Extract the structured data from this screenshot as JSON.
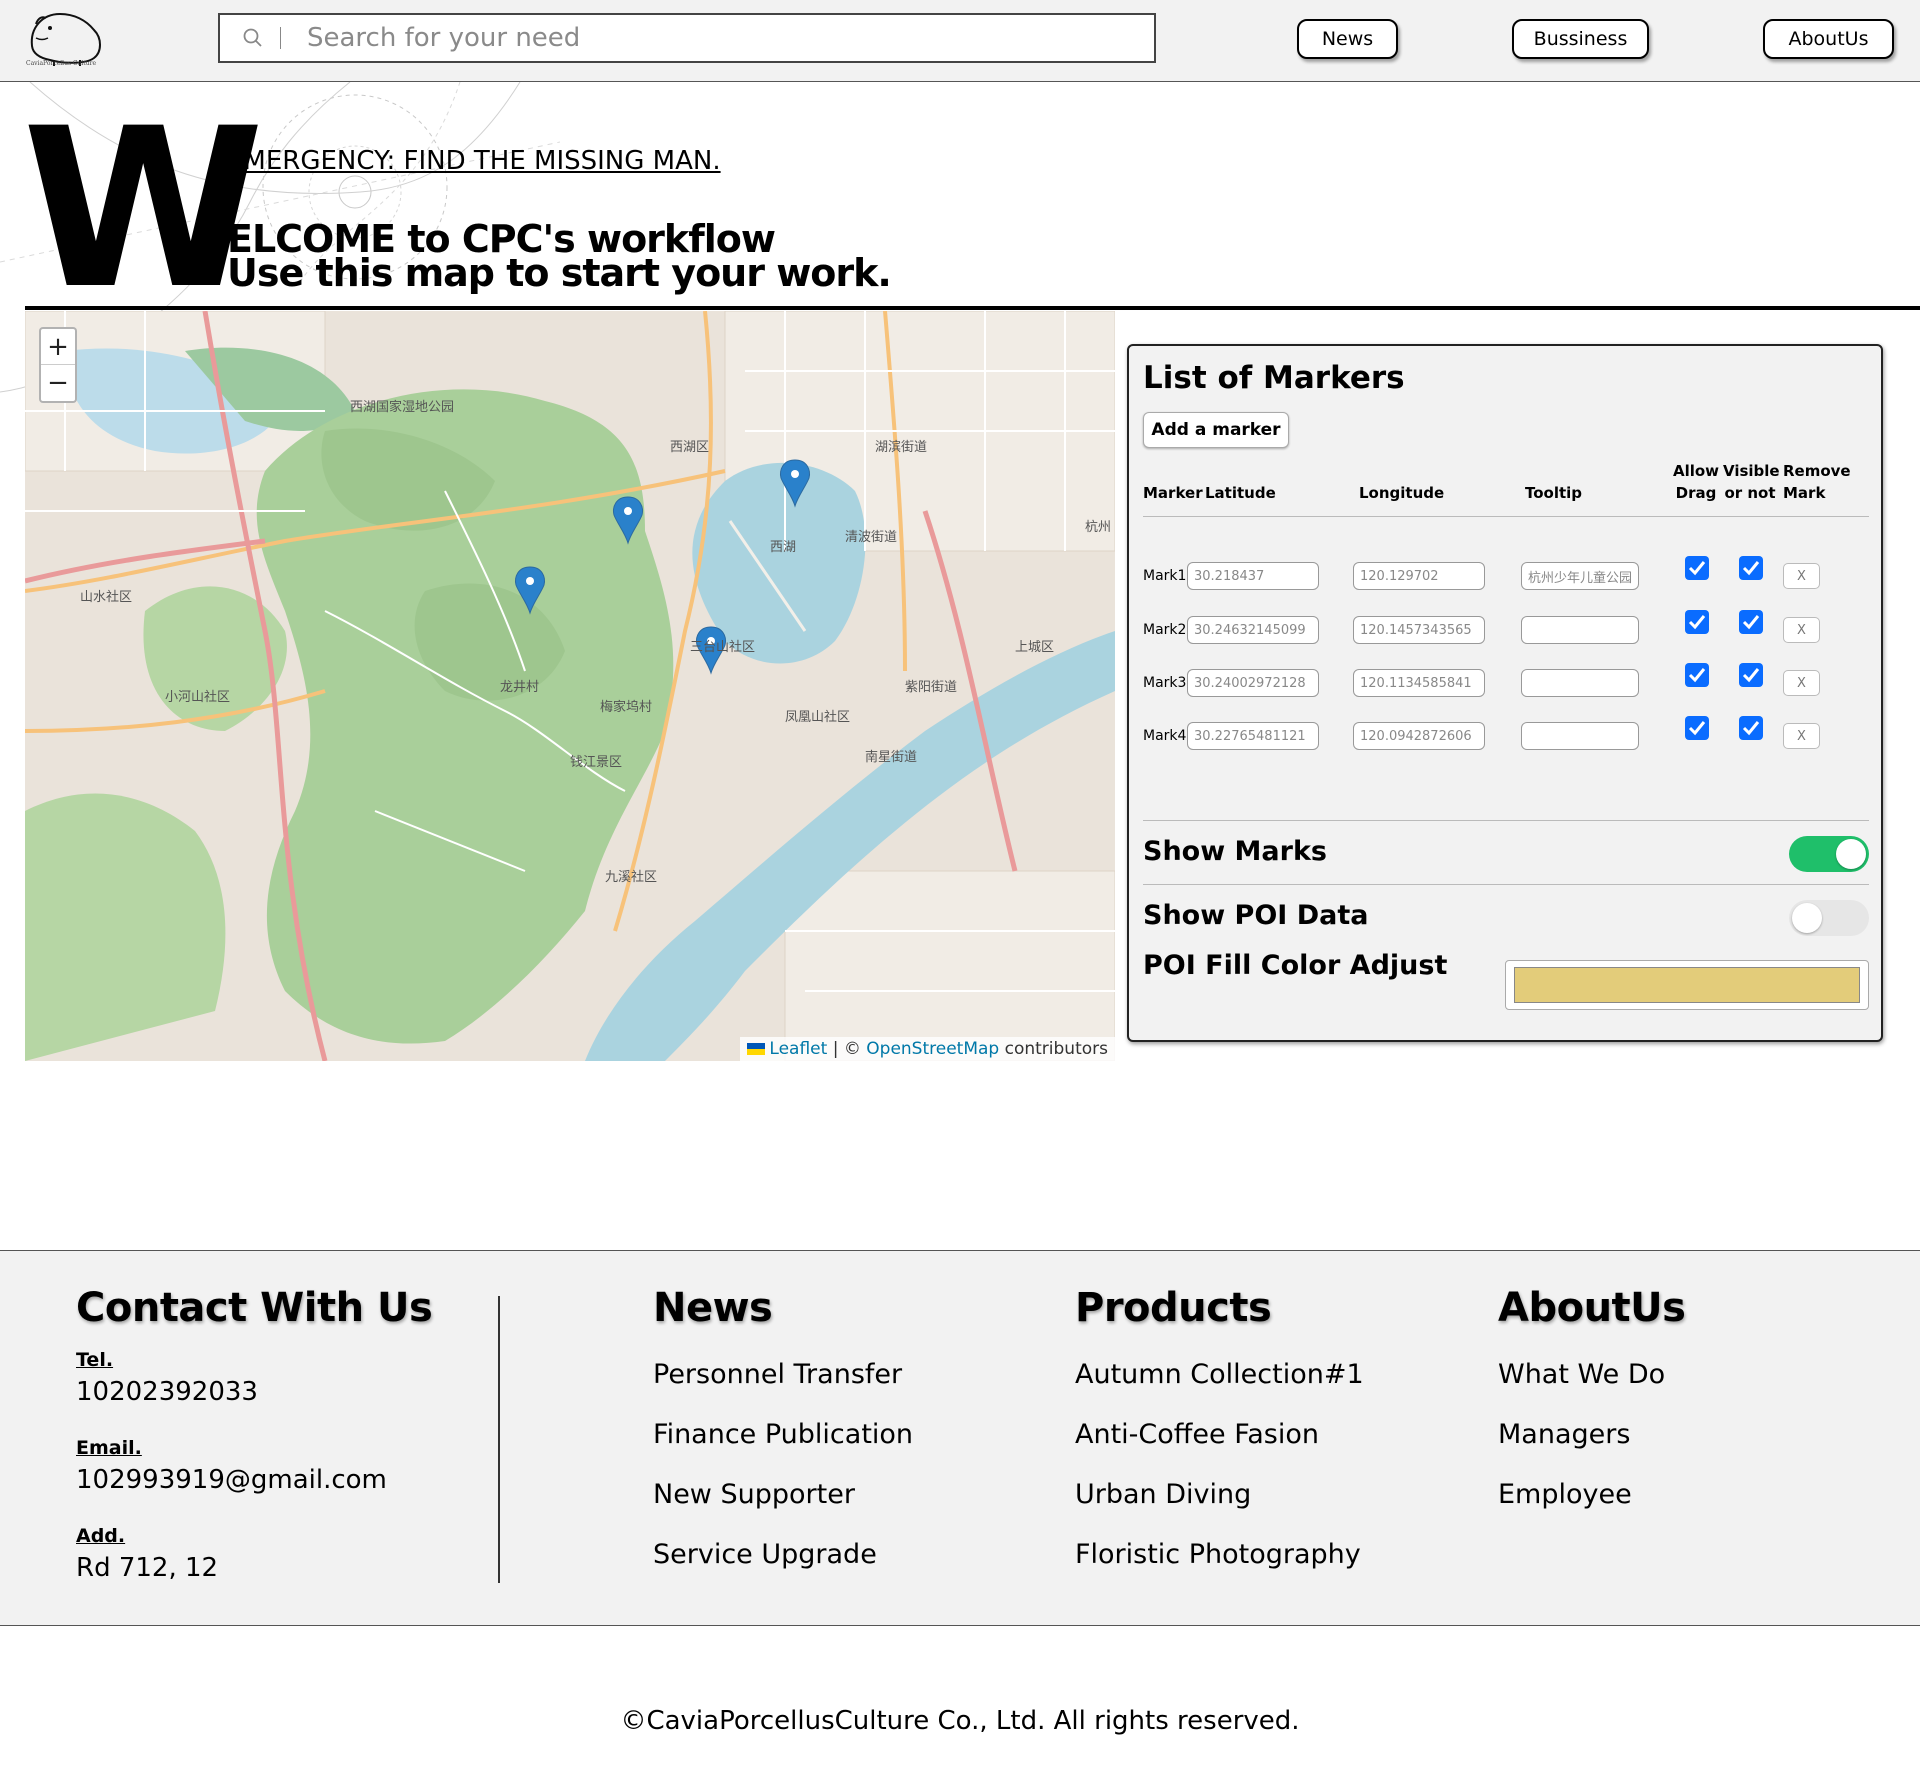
{
  "header": {
    "logo_caption": "CaviaPorcellus Culture",
    "search_placeholder": "Search for your need",
    "nav": [
      "News",
      "Bussiness",
      "AboutUs"
    ]
  },
  "hero": {
    "big_letter": "W",
    "emergency": "EMERGENCY: FIND THE MISSING MAN.",
    "welcome_line1": "ELCOME to CPC's workflow",
    "welcome_line2": "Use this map to start your work."
  },
  "map": {
    "zoom_in": "+",
    "zoom_out": "−",
    "attribution_leaflet": "Leaflet",
    "attribution_sep": "| ©",
    "attribution_osm": "OpenStreetMap",
    "attribution_suffix": "contributors",
    "labels": [
      "西湖区",
      "西湖",
      "杭州",
      "上城区",
      "龙井村",
      "钱江景区",
      "西湖国家湿地公园",
      "三台山社区",
      "九溪社区",
      "梅家坞村",
      "小河山社区",
      "山水社区",
      "凤凰山社区",
      "南星街道",
      "紫阳街道",
      "清波街道",
      "湖滨街道"
    ]
  },
  "panel": {
    "title": "List of Markers",
    "add_button": "Add a marker",
    "headers": {
      "marker": "Marker",
      "latitude": "Latitude",
      "longitude": "Longitude",
      "tooltip": "Tooltip",
      "allow_drag_1": "Allow",
      "allow_drag_2": "Drag",
      "visible_1": "Visible",
      "visible_2": "or not",
      "remove_1": "Remove",
      "remove_2": "Mark"
    },
    "rows": [
      {
        "label": "Mark1",
        "lat": "30.218437",
        "lng": "120.129702",
        "tooltip": "杭州少年儿童公园",
        "drag": true,
        "visible": true,
        "remove": "X"
      },
      {
        "label": "Mark2",
        "lat": "30.24632145099",
        "lng": "120.1457343565",
        "tooltip": "",
        "drag": true,
        "visible": true,
        "remove": "X"
      },
      {
        "label": "Mark3",
        "lat": "30.24002972128",
        "lng": "120.1134585841",
        "tooltip": "",
        "drag": true,
        "visible": true,
        "remove": "X"
      },
      {
        "label": "Mark4",
        "lat": "30.22765481121",
        "lng": "120.0942872606",
        "tooltip": "",
        "drag": true,
        "visible": true,
        "remove": "X"
      }
    ],
    "show_marks": {
      "label": "Show Marks",
      "on": true
    },
    "show_poi": {
      "label": "Show POI Data",
      "on": false
    },
    "poi_color": {
      "label": "POI Fill Color Adjust",
      "value": "#e3cc7a"
    },
    "toggle_on_color": "#1fbf6a",
    "toggle_off_color": "#e6e6e6",
    "checkbox_color": "#0a6cff"
  },
  "footer": {
    "contact": {
      "heading": "Contact With Us",
      "tel_label": "Tel.",
      "tel": "10202392033",
      "email_label": "Email.",
      "email": "102993919@gmail.com",
      "add_label": "Add.",
      "add": "Rd 712, 12"
    },
    "news": {
      "heading": "News",
      "links": [
        "Personnel Transfer",
        "Finance Publication",
        "New Supporter",
        "Service Upgrade"
      ]
    },
    "products": {
      "heading": "Products",
      "links": [
        "Autumn Collection#1",
        "Anti-Coffee Fasion",
        "Urban Diving",
        "Floristic Photography"
      ]
    },
    "about": {
      "heading": "AboutUs",
      "links": [
        "What We Do",
        "Managers",
        "Employee"
      ]
    },
    "copyright": "©CaviaPorcellusCulture Co., Ltd. All rights reserved."
  }
}
